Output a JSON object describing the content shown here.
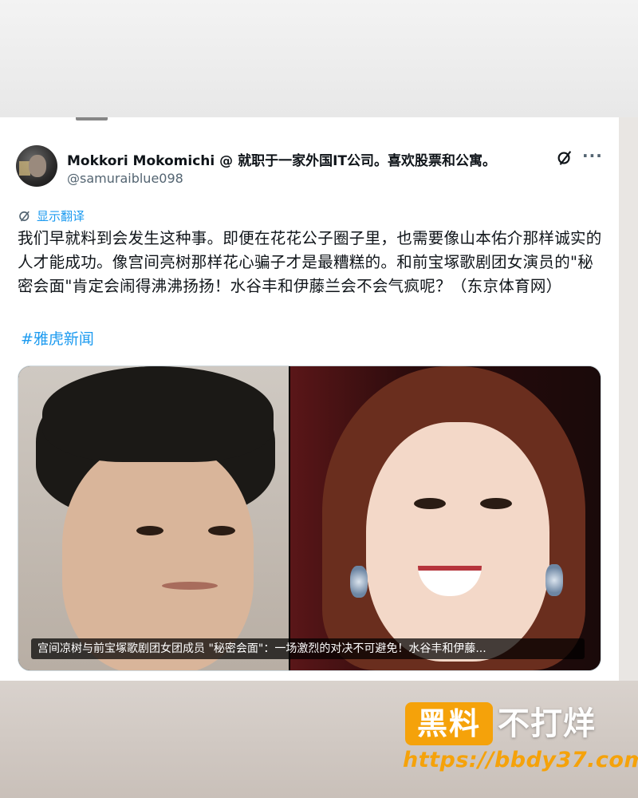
{
  "tweet": {
    "author_name": "Mokkori Mokomichi @ 就职于一家外国IT公司。喜欢股票和公寓。",
    "author_handle": "@samuraiblue098",
    "translate_label": "显示翻译",
    "text": "我们早就料到会发生这种事。即便在花花公子圈子里，也需要像山本佑介那样诚实的人才能成功。像宫间亮树那样花心骗子才是最糟糕的。和前宝塚歌剧团女演员的\"秘密会面\"肯定会闹得沸沸扬扬！水谷丰和伊藤兰会不会气疯呢？（东京体育网）",
    "hashtag": "#雅虎新闻",
    "media_caption": "宫间凉树与前宝塚歌剧团女团成员 \"秘密会面\"：一场激烈的对决不可避免！水谷丰和伊藤...",
    "icons": {
      "grok": "grok-icon",
      "more": "more-icon",
      "translate": "translate-icon"
    }
  },
  "watermark": {
    "box_text": "黑料",
    "text": "不打烊",
    "url": "https://bbdy37.com",
    "accent_color": "#f5a20a"
  }
}
